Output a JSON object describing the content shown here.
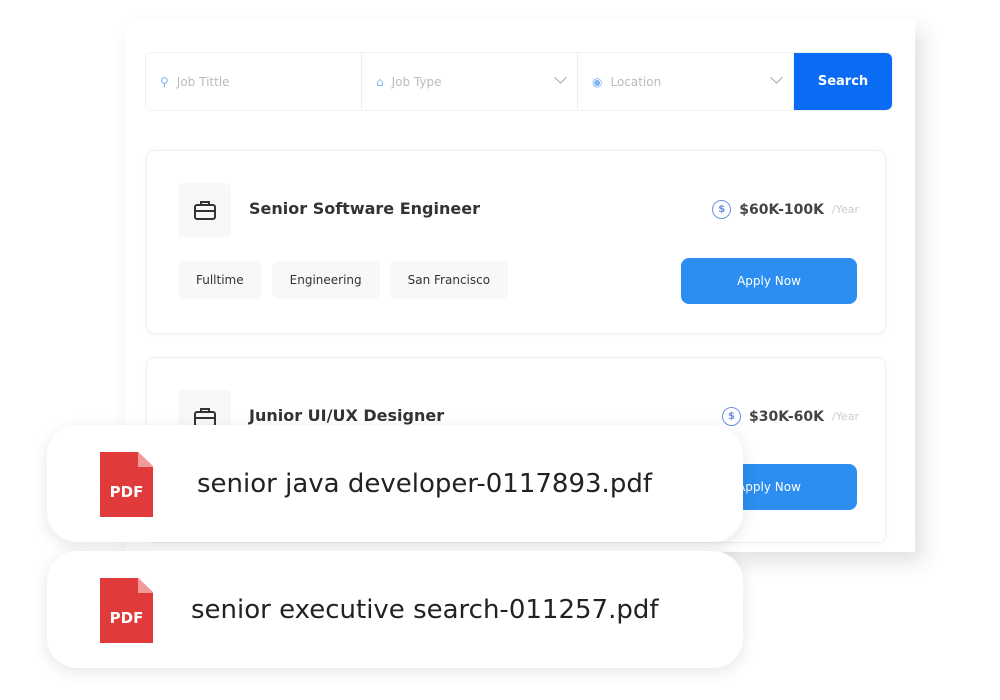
{
  "search": {
    "job_title_placeholder": "Job Tittle",
    "job_type_placeholder": "Job Type",
    "location_placeholder": "Location",
    "button": "Search"
  },
  "jobs": [
    {
      "title": "Senior Software Engineer",
      "salary": "$60K-100K",
      "period": "/Year",
      "tags": [
        "Fulltime",
        "Engineering",
        "San Francisco"
      ],
      "apply": "Apply Now"
    },
    {
      "title": "Junior UI/UX Designer",
      "salary": "$30K-60K",
      "period": "/Year",
      "apply": "Apply Now"
    }
  ],
  "files": [
    {
      "icon_label": "PDF",
      "name": "senior java developer-0117893.pdf"
    },
    {
      "icon_label": "PDF",
      "name": "senior executive search-011257.pdf"
    }
  ],
  "colors": {
    "search_button": "#0a6cf5",
    "apply_button": "#2b8ef0",
    "pdf_icon": "#e03a3a"
  }
}
